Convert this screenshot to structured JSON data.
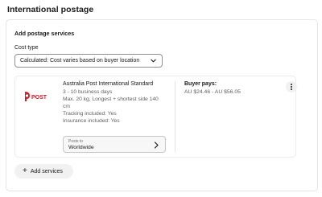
{
  "page_title": "International postage",
  "section_title": "Add postage services",
  "cost_type": {
    "label": "Cost type",
    "selected": "Calculated: Cost varies based on buyer location",
    "icon": "chevron-down-icon"
  },
  "service": {
    "logo_text": "POST",
    "name": "Australia Post International Standard",
    "lines": [
      "3 - 10 business days",
      "Max. 20 kg, Longest + shortest side 140",
      "cm",
      "Tracking included: Yes",
      "Insurance included: Yes"
    ],
    "posts_to_label": "Posts to",
    "posts_to_value": "Worldwide",
    "buyer_pays_label": "Buyer pays:",
    "buyer_pays_value": "AU $24.46 - AU $56.05",
    "logo_color": "#dc1928"
  },
  "add_services_label": "Add services",
  "colors": {
    "text": "#191919",
    "muted": "#5f5f5f",
    "border": "#e5e5e5",
    "button_bg": "#f1f1f1"
  }
}
